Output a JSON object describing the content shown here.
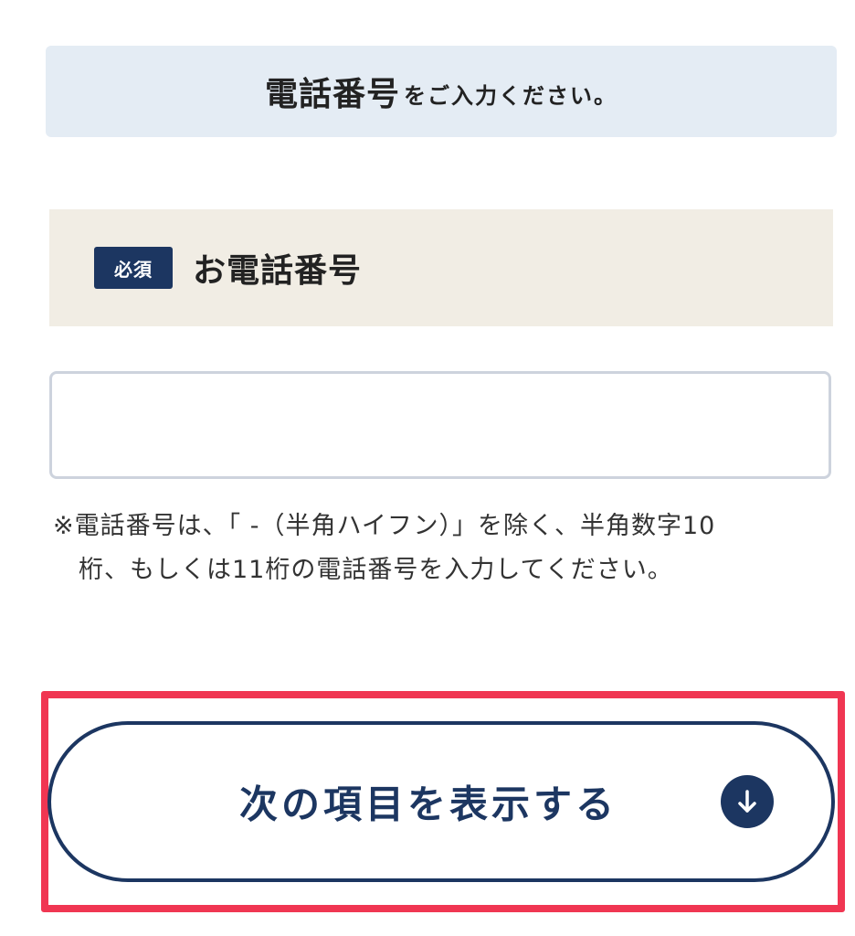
{
  "banner": {
    "emphasis": "電話番号",
    "suffix": "をご入力ください。"
  },
  "field": {
    "required_badge": "必須",
    "label": "お電話番号",
    "input_value": "",
    "input_placeholder": ""
  },
  "note": {
    "line1": "※電話番号は、「 -（半角ハイフン）」を除く、半角数字10",
    "line2": "桁、もしくは11桁の電話番号を入力してください。"
  },
  "next_button": {
    "label": "次の項目を表示する",
    "icon": "arrow-down-circle-icon"
  },
  "colors": {
    "navy": "#1c3661",
    "banner_bg": "#e4ecf4",
    "header_bg": "#f1ede4",
    "highlight": "#f03652",
    "input_border": "#cdd3dd"
  }
}
